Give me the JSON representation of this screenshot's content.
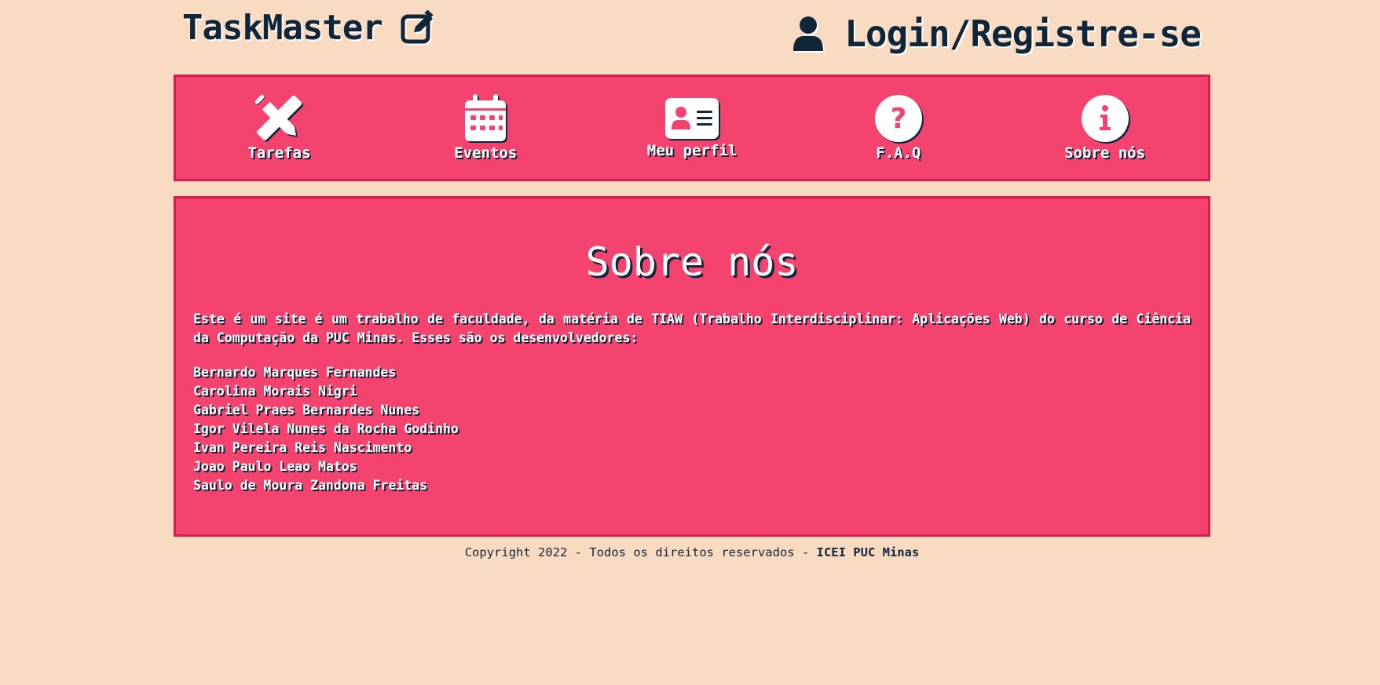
{
  "header": {
    "brand": "TaskMaster",
    "brand_icon": "edit-icon",
    "login_label": "Login/Registre-se",
    "login_icon": "user-icon"
  },
  "nav": {
    "items": [
      {
        "label": "Tarefas",
        "icon": "pencil-ruler-icon"
      },
      {
        "label": "Eventos",
        "icon": "calendar-icon"
      },
      {
        "label": "Meu perfil",
        "icon": "id-card-icon"
      },
      {
        "label": "F.A.Q",
        "icon": "question-circle-icon"
      },
      {
        "label": "Sobre nós",
        "icon": "info-circle-icon"
      }
    ]
  },
  "main": {
    "title": "Sobre nós",
    "intro": "Este é um site é um trabalho de faculdade, da matéria de TIAW (Trabalho Interdisciplinar: Aplicações Web) do curso de Ciência da Computação da PUC Minas. Esses são os desenvolvedores:",
    "developers": [
      "Bernardo Marques Fernandes",
      "Carolina Morais Nigri",
      "Gabriel Praes Bernardes Nunes",
      "Igor Vilela Nunes da Rocha Godinho",
      "Ivan Pereira Reis Nascimento",
      "Joao Paulo Leao Matos",
      "Saulo de Moura Zandona Freitas"
    ]
  },
  "footer": {
    "text": "Copyright 2022 - Todos os direitos reservados - ",
    "bold": "ICEI PUC Minas"
  },
  "colors": {
    "background": "#f9dbc2",
    "panel": "#f5436f",
    "panel_border": "#d61c4c",
    "text_dark": "#12263a",
    "text_light": "#ffffff"
  }
}
